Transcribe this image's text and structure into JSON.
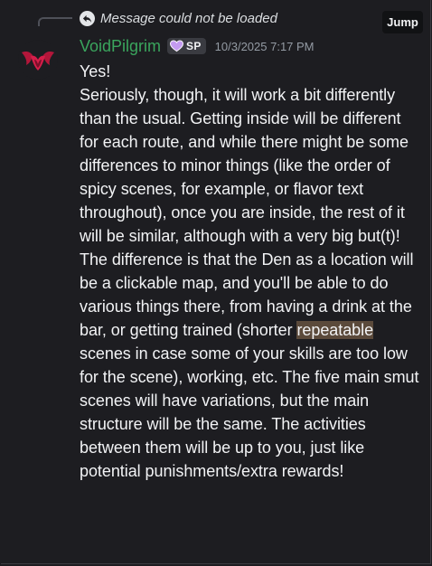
{
  "reply": {
    "text": "Message could not be loaded",
    "jump_label": "Jump"
  },
  "author": {
    "name": "VoidPilgrim",
    "tag": "SP",
    "timestamp": "10/3/2025 7:17 PM",
    "name_color": "#3aa55d"
  },
  "message": {
    "para1": "Yes!",
    "para2": "Seriously, though, it will work a bit differently than the usual. Getting inside will be different for each route, and while there might be some differences to minor things (like the order of spicy scenes, for example, or flavor text throughout), once you are inside, the rest of it will be similar, although with a very big but(t)!",
    "para3_before": "The difference is that the Den as a location will be a clickable map, and you'll be able to do various things there, from having a drink at the bar, or getting trained (shorter ",
    "para3_highlight": "repeatable",
    "para3_after": " scenes in case some of your skills are too low for the scene), working, etc. The five main smut scenes will have variations, but the main structure will be the same. The activities between them will be up to you, just like potential punishments/extra rewards!"
  },
  "icons": {
    "reply": "reply-arrow-icon",
    "tag": "purple-heart-icon",
    "avatar": "red-wings-icon"
  },
  "colors": {
    "background": "#1d1d21",
    "highlight": "#5b4a3b",
    "tag_heart": "#c49bf0"
  }
}
